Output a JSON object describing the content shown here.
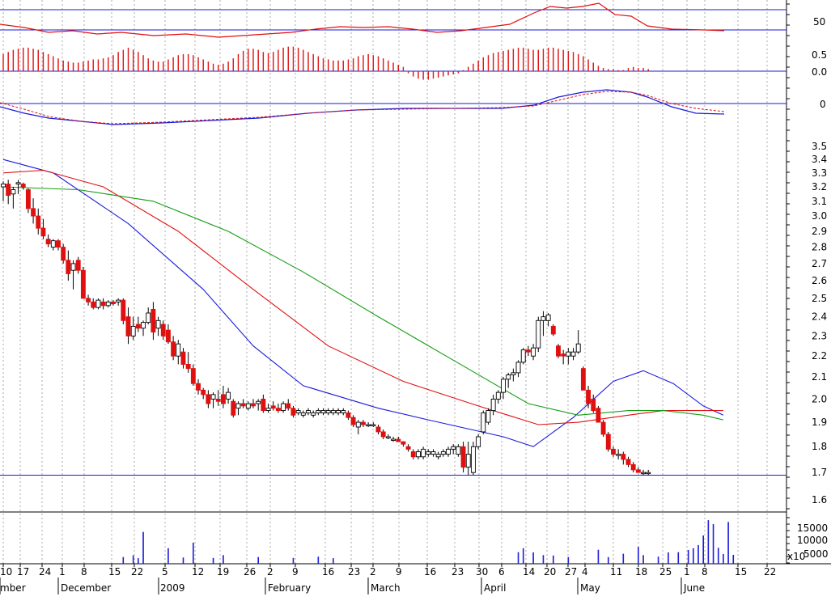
{
  "chart_data": {
    "type": "candlestick",
    "price_axis": {
      "ticks": [
        1.6,
        1.7,
        1.8,
        1.9,
        2.0,
        2.1,
        2.2,
        2.3,
        2.4,
        2.5,
        2.6,
        2.7,
        2.8,
        2.9,
        3.0,
        3.1,
        3.2,
        3.3,
        3.4,
        3.5
      ],
      "tick_labels": [
        "1.6",
        "1.7",
        "1.8",
        "1.9",
        "2.0",
        "2.1",
        "2.2",
        "2.3",
        "2.4",
        "2.5",
        "2.6",
        "2.7",
        "2.8",
        "2.9",
        "3.0",
        "3.1",
        "3.2",
        "3.3",
        "3.4",
        "3.5"
      ],
      "scale": "log",
      "range": [
        1.55,
        3.6
      ],
      "reference_line": 1.69
    },
    "rsi_panel": {
      "tick_label": "50",
      "reference_line": 50
    },
    "momentum_panel": {
      "tick_labels": [
        "0.5",
        "0.0"
      ],
      "reference_line": 0.0
    },
    "macd_panel": {
      "tick_label": "0",
      "reference_line": 0
    },
    "volume_panel": {
      "tick_labels": [
        "15000",
        "10000",
        "5000"
      ],
      "multiplier_label": "x10"
    },
    "x_axis": {
      "day_labels": [
        "10",
        "17",
        "24",
        "1",
        "8",
        "15",
        "22",
        "5",
        "12",
        "19",
        "26",
        "2",
        "9",
        "16",
        "23",
        "2",
        "9",
        "16",
        "23",
        "30",
        "6",
        "14",
        "20",
        "27",
        "4",
        "11",
        "18",
        "25",
        "1",
        "8",
        "15",
        "22"
      ],
      "month_labels": [
        "mber",
        "December",
        "2009",
        "February",
        "March",
        "April",
        "May",
        "June"
      ]
    },
    "candles": [
      [
        3.2,
        3.24,
        3.1,
        3.22
      ],
      [
        3.22,
        3.25,
        3.08,
        3.14
      ],
      [
        3.15,
        3.2,
        3.05,
        3.18
      ],
      [
        3.22,
        3.25,
        3.15,
        3.23
      ],
      [
        3.22,
        3.23,
        3.18,
        3.2
      ],
      [
        3.18,
        3.19,
        3.02,
        3.05
      ],
      [
        3.05,
        3.12,
        2.95,
        3.0
      ],
      [
        3.0,
        3.05,
        2.88,
        2.92
      ],
      [
        2.92,
        2.98,
        2.85,
        2.87
      ],
      [
        2.85,
        2.88,
        2.8,
        2.82
      ],
      [
        2.8,
        2.85,
        2.78,
        2.84
      ],
      [
        2.84,
        2.85,
        2.78,
        2.8
      ],
      [
        2.8,
        2.82,
        2.7,
        2.72
      ],
      [
        2.72,
        2.78,
        2.6,
        2.64
      ],
      [
        2.66,
        2.72,
        2.55,
        2.7
      ],
      [
        2.72,
        2.74,
        2.64,
        2.66
      ],
      [
        2.66,
        2.68,
        2.52,
        2.5
      ],
      [
        2.5,
        2.52,
        2.46,
        2.48
      ],
      [
        2.48,
        2.5,
        2.44,
        2.45
      ],
      [
        2.45,
        2.5,
        2.44,
        2.49
      ],
      [
        2.48,
        2.5,
        2.44,
        2.46
      ],
      [
        2.46,
        2.49,
        2.45,
        2.48
      ],
      [
        2.48,
        2.49,
        2.46,
        2.47
      ],
      [
        2.48,
        2.5,
        2.46,
        2.49
      ],
      [
        2.49,
        2.5,
        2.36,
        2.38
      ],
      [
        2.4,
        2.45,
        2.26,
        2.3
      ],
      [
        2.3,
        2.4,
        2.28,
        2.35
      ],
      [
        2.36,
        2.4,
        2.32,
        2.34
      ],
      [
        2.34,
        2.38,
        2.3,
        2.37
      ],
      [
        2.37,
        2.45,
        2.36,
        2.42
      ],
      [
        2.44,
        2.48,
        2.28,
        2.32
      ],
      [
        2.34,
        2.4,
        2.3,
        2.38
      ],
      [
        2.36,
        2.38,
        2.28,
        2.3
      ],
      [
        2.33,
        2.36,
        2.26,
        2.27
      ],
      [
        2.27,
        2.3,
        2.18,
        2.2
      ],
      [
        2.2,
        2.28,
        2.16,
        2.26
      ],
      [
        2.22,
        2.24,
        2.14,
        2.16
      ],
      [
        2.16,
        2.22,
        2.12,
        2.14
      ],
      [
        2.14,
        2.16,
        2.06,
        2.07
      ],
      [
        2.07,
        2.09,
        2.02,
        2.04
      ],
      [
        2.04,
        2.05,
        2.0,
        2.02
      ],
      [
        2.02,
        2.04,
        1.96,
        1.98
      ],
      [
        2.0,
        2.03,
        1.96,
        2.02
      ],
      [
        2.0,
        2.04,
        1.97,
        1.99
      ],
      [
        2.02,
        2.06,
        1.96,
        1.98
      ],
      [
        2.0,
        2.05,
        1.98,
        2.03
      ],
      [
        1.99,
        2.0,
        1.92,
        1.93
      ],
      [
        1.96,
        1.99,
        1.93,
        1.98
      ],
      [
        1.98,
        2.0,
        1.96,
        1.97
      ],
      [
        1.96,
        1.99,
        1.95,
        1.98
      ],
      [
        1.98,
        2.0,
        1.96,
        1.97
      ],
      [
        1.98,
        2.0,
        1.95,
        1.99
      ],
      [
        2.0,
        2.02,
        1.94,
        1.95
      ],
      [
        1.95,
        1.98,
        1.94,
        1.96
      ],
      [
        1.97,
        1.99,
        1.95,
        1.96
      ],
      [
        1.96,
        1.98,
        1.94,
        1.95
      ],
      [
        1.95,
        1.99,
        1.94,
        1.98
      ],
      [
        1.98,
        2.0,
        1.95,
        1.96
      ],
      [
        1.96,
        1.97,
        1.92,
        1.93
      ],
      [
        1.94,
        1.96,
        1.93,
        1.95
      ],
      [
        1.93,
        1.95,
        1.92,
        1.94
      ],
      [
        1.94,
        1.96,
        1.93,
        1.95
      ],
      [
        1.93,
        1.95,
        1.92,
        1.94
      ],
      [
        1.94,
        1.96,
        1.93,
        1.95
      ],
      [
        1.94,
        1.96,
        1.93,
        1.95
      ],
      [
        1.94,
        1.96,
        1.93,
        1.95
      ],
      [
        1.94,
        1.96,
        1.93,
        1.95
      ],
      [
        1.94,
        1.96,
        1.93,
        1.95
      ],
      [
        1.94,
        1.96,
        1.93,
        1.95
      ],
      [
        1.94,
        1.95,
        1.91,
        1.92
      ],
      [
        1.92,
        1.93,
        1.88,
        1.89
      ],
      [
        1.88,
        1.91,
        1.85,
        1.9
      ],
      [
        1.9,
        1.91,
        1.88,
        1.89
      ],
      [
        1.89,
        1.9,
        1.88,
        1.89
      ],
      [
        1.89,
        1.9,
        1.88,
        1.89
      ],
      [
        1.88,
        1.89,
        1.85,
        1.86
      ],
      [
        1.86,
        1.87,
        1.83,
        1.84
      ],
      [
        1.84,
        1.85,
        1.83,
        1.84
      ],
      [
        1.83,
        1.84,
        1.82,
        1.83
      ],
      [
        1.83,
        1.84,
        1.82,
        1.82
      ],
      [
        1.82,
        1.82,
        1.8,
        1.81
      ],
      [
        1.8,
        1.81,
        1.78,
        1.79
      ],
      [
        1.78,
        1.79,
        1.75,
        1.76
      ],
      [
        1.76,
        1.79,
        1.75,
        1.78
      ],
      [
        1.76,
        1.8,
        1.75,
        1.79
      ],
      [
        1.77,
        1.79,
        1.76,
        1.78
      ],
      [
        1.77,
        1.79,
        1.76,
        1.78
      ],
      [
        1.76,
        1.78,
        1.75,
        1.77
      ],
      [
        1.77,
        1.79,
        1.76,
        1.78
      ],
      [
        1.77,
        1.8,
        1.76,
        1.79
      ],
      [
        1.79,
        1.81,
        1.77,
        1.8
      ],
      [
        1.77,
        1.81,
        1.76,
        1.8
      ],
      [
        1.8,
        1.82,
        1.7,
        1.72
      ],
      [
        1.72,
        1.82,
        1.69,
        1.77
      ],
      [
        1.7,
        1.82,
        1.69,
        1.8
      ],
      [
        1.8,
        1.85,
        1.79,
        1.84
      ],
      [
        1.86,
        1.95,
        1.85,
        1.94
      ],
      [
        1.9,
        1.96,
        1.89,
        1.95
      ],
      [
        1.95,
        2.02,
        1.93,
        2.0
      ],
      [
        2.0,
        2.04,
        1.98,
        2.03
      ],
      [
        2.03,
        2.1,
        2.0,
        2.09
      ],
      [
        2.09,
        2.12,
        2.05,
        2.11
      ],
      [
        2.11,
        2.14,
        2.08,
        2.12
      ],
      [
        2.12,
        2.18,
        2.1,
        2.17
      ],
      [
        2.17,
        2.24,
        2.16,
        2.23
      ],
      [
        2.23,
        2.25,
        2.2,
        2.22
      ],
      [
        2.2,
        2.26,
        2.18,
        2.24
      ],
      [
        2.24,
        2.4,
        2.22,
        2.38
      ],
      [
        2.38,
        2.43,
        2.3,
        2.4
      ],
      [
        2.38,
        2.42,
        2.35,
        2.41
      ],
      [
        2.35,
        2.36,
        2.3,
        2.31
      ],
      [
        2.25,
        2.26,
        2.19,
        2.2
      ],
      [
        2.21,
        2.23,
        2.16,
        2.2
      ],
      [
        2.2,
        2.24,
        2.16,
        2.22
      ],
      [
        2.2,
        2.24,
        2.18,
        2.22
      ],
      [
        2.22,
        2.33,
        2.21,
        2.26
      ],
      [
        2.14,
        2.15,
        2.08,
        2.04
      ],
      [
        2.04,
        2.06,
        1.96,
        1.98
      ],
      [
        2.0,
        2.02,
        1.94,
        1.95
      ],
      [
        1.96,
        1.97,
        1.9,
        1.9
      ],
      [
        1.9,
        1.91,
        1.84,
        1.85
      ],
      [
        1.85,
        1.86,
        1.78,
        1.79
      ],
      [
        1.79,
        1.8,
        1.76,
        1.77
      ],
      [
        1.77,
        1.79,
        1.75,
        1.77
      ],
      [
        1.77,
        1.78,
        1.73,
        1.75
      ],
      [
        1.75,
        1.76,
        1.72,
        1.73
      ],
      [
        1.73,
        1.74,
        1.7,
        1.71
      ],
      [
        1.71,
        1.72,
        1.7,
        1.7
      ],
      [
        1.7,
        1.71,
        1.69,
        1.7
      ],
      [
        1.7,
        1.71,
        1.69,
        1.7
      ]
    ],
    "moving_averages": [
      {
        "color": "#1a1adc",
        "values": [
          [
            0,
            3.4
          ],
          [
            10,
            3.3
          ],
          [
            25,
            2.95
          ],
          [
            40,
            2.55
          ],
          [
            50,
            2.25
          ],
          [
            60,
            2.06
          ],
          [
            75,
            1.96
          ],
          [
            85,
            1.91
          ],
          [
            100,
            1.84
          ],
          [
            106,
            1.8
          ],
          [
            114,
            1.92
          ],
          [
            122,
            2.08
          ],
          [
            128,
            2.13
          ],
          [
            134,
            2.07
          ],
          [
            140,
            1.97
          ],
          [
            144,
            1.93
          ]
        ]
      },
      {
        "color": "#e01010",
        "values": [
          [
            0,
            3.3
          ],
          [
            8,
            3.32
          ],
          [
            20,
            3.2
          ],
          [
            35,
            2.9
          ],
          [
            50,
            2.55
          ],
          [
            65,
            2.25
          ],
          [
            80,
            2.08
          ],
          [
            95,
            1.97
          ],
          [
            107,
            1.89
          ],
          [
            115,
            1.9
          ],
          [
            125,
            1.93
          ],
          [
            132,
            1.95
          ],
          [
            140,
            1.95
          ],
          [
            144,
            1.95
          ]
        ]
      },
      {
        "color": "#149c14",
        "values": [
          [
            0,
            3.2
          ],
          [
            15,
            3.18
          ],
          [
            30,
            3.1
          ],
          [
            45,
            2.9
          ],
          [
            60,
            2.65
          ],
          [
            75,
            2.4
          ],
          [
            90,
            2.18
          ],
          [
            105,
            1.98
          ],
          [
            115,
            1.93
          ],
          [
            125,
            1.95
          ],
          [
            132,
            1.95
          ],
          [
            140,
            1.93
          ],
          [
            144,
            1.91
          ]
        ]
      }
    ],
    "volume": [
      {
        "i": 24,
        "v": 3000
      },
      {
        "i": 26,
        "v": 3800
      },
      {
        "i": 27,
        "v": 2500
      },
      {
        "i": 28,
        "v": 14300
      },
      {
        "i": 33,
        "v": 7000
      },
      {
        "i": 36,
        "v": 2800
      },
      {
        "i": 38,
        "v": 9500
      },
      {
        "i": 42,
        "v": 2600
      },
      {
        "i": 44,
        "v": 3900
      },
      {
        "i": 51,
        "v": 3000
      },
      {
        "i": 58,
        "v": 2600
      },
      {
        "i": 63,
        "v": 3200
      },
      {
        "i": 66,
        "v": 2500
      },
      {
        "i": 103,
        "v": 5200
      },
      {
        "i": 104,
        "v": 7000
      },
      {
        "i": 106,
        "v": 5100
      },
      {
        "i": 108,
        "v": 3900
      },
      {
        "i": 110,
        "v": 3700
      },
      {
        "i": 113,
        "v": 3000
      },
      {
        "i": 119,
        "v": 6300
      },
      {
        "i": 121,
        "v": 3000
      },
      {
        "i": 124,
        "v": 4500
      },
      {
        "i": 127,
        "v": 7600
      },
      {
        "i": 128,
        "v": 3900
      },
      {
        "i": 131,
        "v": 3200
      },
      {
        "i": 133,
        "v": 5100
      },
      {
        "i": 135,
        "v": 5200
      },
      {
        "i": 137,
        "v": 6200
      },
      {
        "i": 138,
        "v": 7000
      },
      {
        "i": 139,
        "v": 8400
      },
      {
        "i": 140,
        "v": 12700
      },
      {
        "i": 141,
        "v": 19600
      },
      {
        "i": 142,
        "v": 17800
      },
      {
        "i": 143,
        "v": 7200
      },
      {
        "i": 144,
        "v": 4400
      },
      {
        "i": 145,
        "v": 18800
      },
      {
        "i": 146,
        "v": 4000
      }
    ],
    "momentum_bars": [
      0.32,
      0.36,
      0.4,
      0.42,
      0.44,
      0.44,
      0.42,
      0.4,
      0.36,
      0.32,
      0.28,
      0.24,
      0.2,
      0.18,
      0.16,
      0.16,
      0.18,
      0.2,
      0.22,
      0.22,
      0.24,
      0.26,
      0.3,
      0.36,
      0.4,
      0.44,
      0.4,
      0.36,
      0.3,
      0.24,
      0.2,
      0.18,
      0.18,
      0.22,
      0.26,
      0.3,
      0.32,
      0.32,
      0.3,
      0.26,
      0.22,
      0.18,
      0.14,
      0.12,
      0.14,
      0.18,
      0.24,
      0.32,
      0.38,
      0.42,
      0.42,
      0.4,
      0.36,
      0.34,
      0.36,
      0.4,
      0.44,
      0.46,
      0.46,
      0.44,
      0.4,
      0.36,
      0.32,
      0.28,
      0.24,
      0.22,
      0.2,
      0.2,
      0.2,
      0.22,
      0.24,
      0.28,
      0.3,
      0.32,
      0.3,
      0.28,
      0.24,
      0.2,
      0.16,
      0.12,
      0.08,
      -0.04,
      -0.1,
      -0.14,
      -0.16,
      -0.16,
      -0.14,
      -0.12,
      -0.1,
      -0.08,
      -0.06,
      -0.04,
      0.02,
      0.08,
      0.14,
      0.2,
      0.26,
      0.3,
      0.34,
      0.36,
      0.38,
      0.4,
      0.42,
      0.44,
      0.44,
      0.42,
      0.4,
      0.4,
      0.42,
      0.44,
      0.44,
      0.42,
      0.4,
      0.38,
      0.36,
      0.32,
      0.28,
      0.22,
      0.16,
      0.1,
      0.06,
      0.04,
      0.04,
      0.02,
      0.02,
      0.06,
      0.08,
      0.06,
      0.06,
      0.04
    ]
  }
}
